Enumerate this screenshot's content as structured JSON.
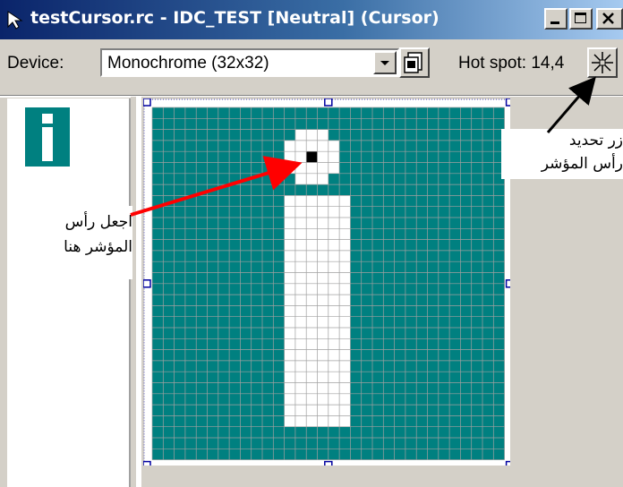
{
  "window": {
    "title": "testCursor.rc - IDC_TEST [Neutral] (Cursor)",
    "caption_buttons": [
      "minimize-icon",
      "maximize-icon",
      "close-icon"
    ]
  },
  "toolbar": {
    "device_label": "Device:",
    "device_value": "Monochrome (32x32)",
    "hotspot_label": "Hot spot:",
    "hotspot_value": "14,4",
    "new_image_icon": "new-device-image-icon",
    "set_hotspot_icon": "set-hotspot-icon"
  },
  "canvas": {
    "grid_size": 32,
    "background_color": "#008080",
    "pixel_color": "#ffffff",
    "hotspot_color": "#000000",
    "hotspot": {
      "col": 14,
      "row": 4
    }
  },
  "annotations": {
    "hotspot_button_note_line1": "زر تحديد",
    "hotspot_button_note_line2": "رأس المؤشر",
    "canvas_note_line1": "اجعل رأس",
    "canvas_note_line2": "المؤشر هنا"
  },
  "colors": {
    "titlebar_start": "#0a246a",
    "titlebar_end": "#a6caf0",
    "arrow_red": "#ff0000",
    "arrow_black": "#000000",
    "selection_handle": "#0000a0"
  }
}
